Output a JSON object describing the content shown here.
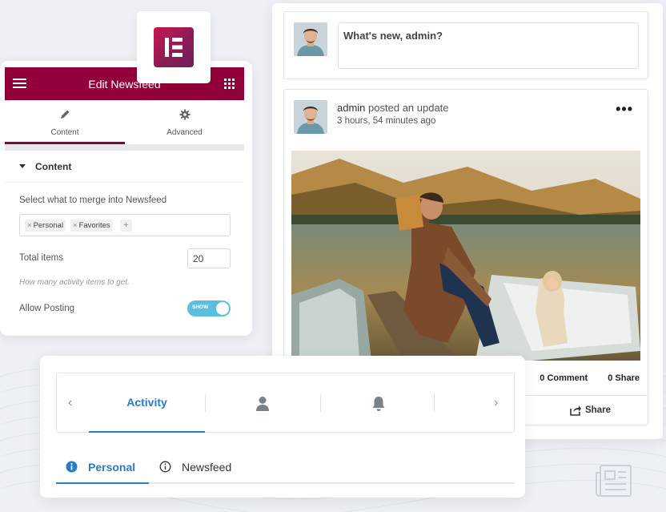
{
  "feed": {
    "composer_placeholder": "What's new, admin?",
    "post": {
      "author": "admin",
      "action": "posted an update",
      "time": "3 hours, 54 minutes ago",
      "menu_glyph": "•••",
      "comment_count": "0 Comment",
      "share_count": "0 Share",
      "share_label": "Share"
    }
  },
  "edit_panel": {
    "title": "Edit Newsfeed",
    "tabs": [
      {
        "label": "Content"
      },
      {
        "label": "Advanced"
      }
    ],
    "section_title": "Content",
    "merge_label": "Select what to merge into Newsfeed",
    "merge_chips": [
      "Personal",
      "Favorites"
    ],
    "chip_remove_glyph": "×",
    "chip_add_glyph": "+",
    "total_items_label": "Total items",
    "total_items_value": "20",
    "total_items_hint": "How many activity items to get.",
    "allow_posting_label": "Allow Posting",
    "allow_posting_toggle": "SHOW",
    "allow_posting_on": true
  },
  "activity_nav": {
    "prev_glyph": "‹",
    "next_glyph": "›",
    "active_tab": "Activity",
    "subtabs": [
      {
        "label": "Personal",
        "active": true
      },
      {
        "label": "Newsfeed",
        "active": false
      }
    ]
  },
  "colors": {
    "elementor_brand": "#91003a",
    "accent_blue": "#2b7cc2",
    "toggle_on": "#5bc0de"
  },
  "icons": {
    "edit_header_left": "hamburger-icon",
    "edit_header_right": "grid-icon",
    "tab_content": "pencil-icon",
    "tab_advanced": "gear-icon",
    "nav_profile": "user-icon",
    "nav_notifications": "bell-icon",
    "post_share": "share-icon",
    "subtab_info": "info-icon",
    "bottom_right": "newspaper-icon"
  }
}
